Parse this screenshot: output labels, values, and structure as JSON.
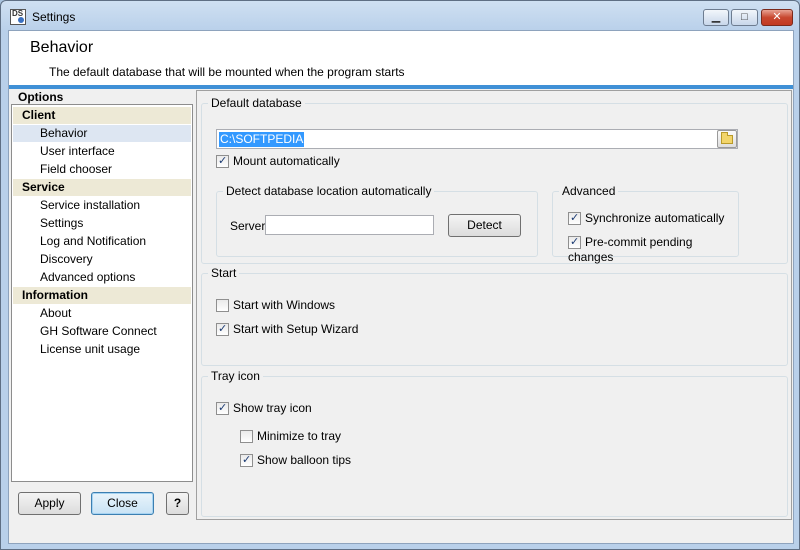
{
  "window": {
    "title": "Settings",
    "app_icon": "DS",
    "minimize": "▁",
    "maximize": "□",
    "close": "✕"
  },
  "header": {
    "title": "Behavior",
    "description": "The default database that will be mounted when the program starts"
  },
  "sidebar": {
    "title": "Options",
    "client": {
      "label": "Client",
      "items": [
        "Behavior",
        "User interface",
        "Field chooser"
      ]
    },
    "service": {
      "label": "Service",
      "items": [
        "Service installation",
        "Settings",
        "Log and Notification",
        "Discovery",
        "Advanced options"
      ]
    },
    "information": {
      "label": "Information",
      "items": [
        "About",
        "GH Software Connect",
        "License unit usage"
      ]
    }
  },
  "buttons": {
    "apply": "Apply",
    "close": "Close",
    "help": "?"
  },
  "default_database": {
    "label": "Default database",
    "path": "C:\\SOFTPEDIA",
    "mount_auto": "Mount automatically",
    "detect_group": "Detect database location automatically",
    "server_label": "Server",
    "server_value": "",
    "detect_button": "Detect",
    "advanced_group": "Advanced",
    "sync_auto": "Synchronize automatically",
    "precommit": "Pre-commit pending changes"
  },
  "start": {
    "label": "Start",
    "with_windows": "Start with Windows",
    "with_wizard": "Start with Setup Wizard"
  },
  "tray": {
    "label": "Tray icon",
    "show_icon": "Show tray icon",
    "minimize": "Minimize to tray",
    "balloon": "Show balloon tips"
  },
  "checks": {
    "mount_auto": true,
    "sync_auto": true,
    "precommit": true,
    "with_windows": false,
    "with_wizard": true,
    "show_icon": true,
    "minimize": false,
    "balloon": true
  }
}
